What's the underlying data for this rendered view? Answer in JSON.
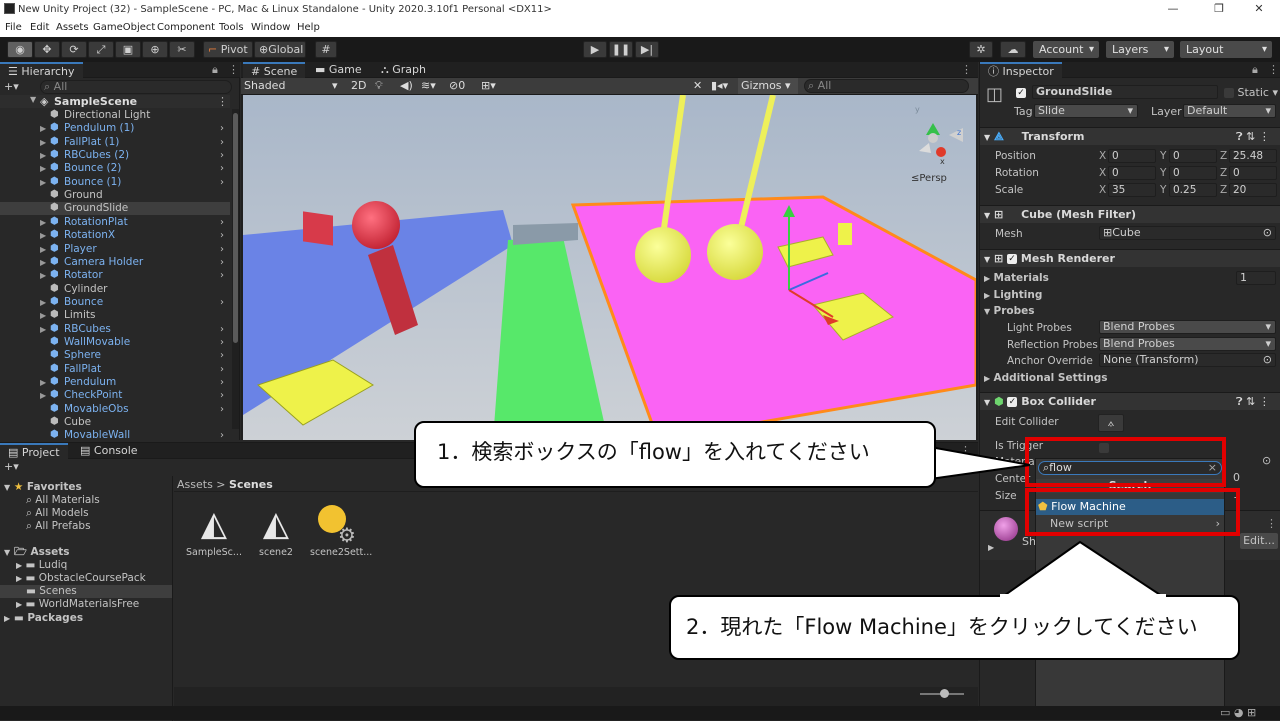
{
  "titlebar": {
    "title": "New Unity Project (32) - SampleScene - PC, Mac & Linux Standalone - Unity 2020.3.10f1 Personal <DX11>"
  },
  "menu": [
    "File",
    "Edit",
    "Assets",
    "GameObject",
    "Component",
    "Tools",
    "Window",
    "Help"
  ],
  "toolbar": {
    "pivot": "Pivot",
    "global": "Global",
    "account": "Account",
    "layers": "Layers",
    "layout": "Layout"
  },
  "hierarchy": {
    "tab": "Hierarchy",
    "search_placeholder": "All",
    "scene": "SampleScene",
    "items": [
      {
        "label": "Directional Light",
        "prefab": false,
        "expand": false
      },
      {
        "label": "Pendulum (1)",
        "prefab": true,
        "expand": true
      },
      {
        "label": "FallPlat (1)",
        "prefab": true,
        "expand": true
      },
      {
        "label": "RBCubes (2)",
        "prefab": true,
        "expand": true
      },
      {
        "label": "Bounce (2)",
        "prefab": true,
        "expand": true
      },
      {
        "label": "Bounce (1)",
        "prefab": true,
        "expand": true
      },
      {
        "label": "Ground",
        "prefab": false,
        "expand": false
      },
      {
        "label": "GroundSlide",
        "prefab": false,
        "expand": false
      },
      {
        "label": "RotationPlat",
        "prefab": true,
        "expand": true
      },
      {
        "label": "RotationX",
        "prefab": true,
        "expand": true
      },
      {
        "label": "Player",
        "prefab": true,
        "expand": true
      },
      {
        "label": "Camera Holder",
        "prefab": true,
        "expand": true
      },
      {
        "label": "Rotator",
        "prefab": true,
        "expand": true
      },
      {
        "label": "Cylinder",
        "prefab": false,
        "expand": false
      },
      {
        "label": "Bounce",
        "prefab": true,
        "expand": true
      },
      {
        "label": "Limits",
        "prefab": false,
        "expand": true
      },
      {
        "label": "RBCubes",
        "prefab": true,
        "expand": true
      },
      {
        "label": "WallMovable",
        "prefab": true,
        "expand": false
      },
      {
        "label": "Sphere",
        "prefab": true,
        "expand": false
      },
      {
        "label": "FallPlat",
        "prefab": true,
        "expand": false
      },
      {
        "label": "Pendulum",
        "prefab": true,
        "expand": true
      },
      {
        "label": "CheckPoint",
        "prefab": true,
        "expand": true
      },
      {
        "label": "MovableObs",
        "prefab": true,
        "expand": false
      },
      {
        "label": "Cube",
        "prefab": false,
        "expand": false
      },
      {
        "label": "MovableWall",
        "prefab": true,
        "expand": false
      }
    ]
  },
  "scene": {
    "tabs": [
      "Scene",
      "Game",
      "Graph"
    ],
    "shading": "Shaded",
    "mode2d": "2D",
    "effects_count": "0",
    "gizmos": "Gizmos",
    "search_placeholder": "All",
    "persp": "≤Persp"
  },
  "project": {
    "tabs": [
      "Project",
      "Console"
    ],
    "favorites_label": "Favorites",
    "favorites": [
      "All Materials",
      "All Models",
      "All Prefabs"
    ],
    "assets_label": "Assets",
    "assets": [
      "Ludiq",
      "ObstacleCoursePack",
      "Scenes",
      "WorldMaterialsFree"
    ],
    "packages_label": "Packages",
    "breadcrumb": [
      "Assets",
      "Scenes"
    ],
    "files": [
      "SampleSc...",
      "scene2",
      "scene2Sett..."
    ]
  },
  "inspector": {
    "tab": "Inspector",
    "object_name": "GroundSlide",
    "static_label": "Static",
    "tag_label": "Tag",
    "tag_value": "Slide",
    "layer_label": "Layer",
    "layer_value": "Default",
    "transform": {
      "title": "Transform",
      "position": {
        "label": "Position",
        "x": "0",
        "y": "0",
        "z": "25.48"
      },
      "rotation": {
        "label": "Rotation",
        "x": "0",
        "y": "0",
        "z": "0"
      },
      "scale": {
        "label": "Scale",
        "x": "35",
        "y": "0.25",
        "z": "20"
      }
    },
    "mesh_filter": {
      "title": "Cube (Mesh Filter)",
      "mesh_label": "Mesh",
      "mesh_value": "Cube"
    },
    "mesh_renderer": {
      "title": "Mesh Renderer",
      "materials_label": "Materials",
      "materials_value": "1",
      "lighting_label": "Lighting",
      "probes_label": "Probes",
      "light_probes_label": "Light Probes",
      "light_probes_value": "Blend Probes",
      "reflection_probes_label": "Reflection Probes",
      "reflection_probes_value": "Blend Probes",
      "anchor_label": "Anchor Override",
      "anchor_value": "None (Transform)",
      "additional_label": "Additional Settings"
    },
    "box_collider": {
      "title": "Box Collider",
      "edit_label": "Edit Collider",
      "trigger_label": "Is Trigger",
      "material_label": "Materia",
      "center_label": "Center",
      "center_value": "0",
      "size_label": "Size",
      "size_value": "1"
    },
    "material_partial": {
      "shader_partial": "Sh",
      "edit_label": "Edit..."
    }
  },
  "add_component_popup": {
    "search_value": "flow",
    "search_title": "Search",
    "items": [
      "Flow Machine",
      "New script"
    ]
  },
  "callouts": {
    "step1": "1．検索ボックスの「flow」を入れてください",
    "step2": "2．現れた「Flow Machine」をクリックしてください"
  },
  "colors": {
    "accent_red": "#e20000",
    "selection_blue": "#2c5d87",
    "prefab_blue": "#7cb2f0"
  }
}
